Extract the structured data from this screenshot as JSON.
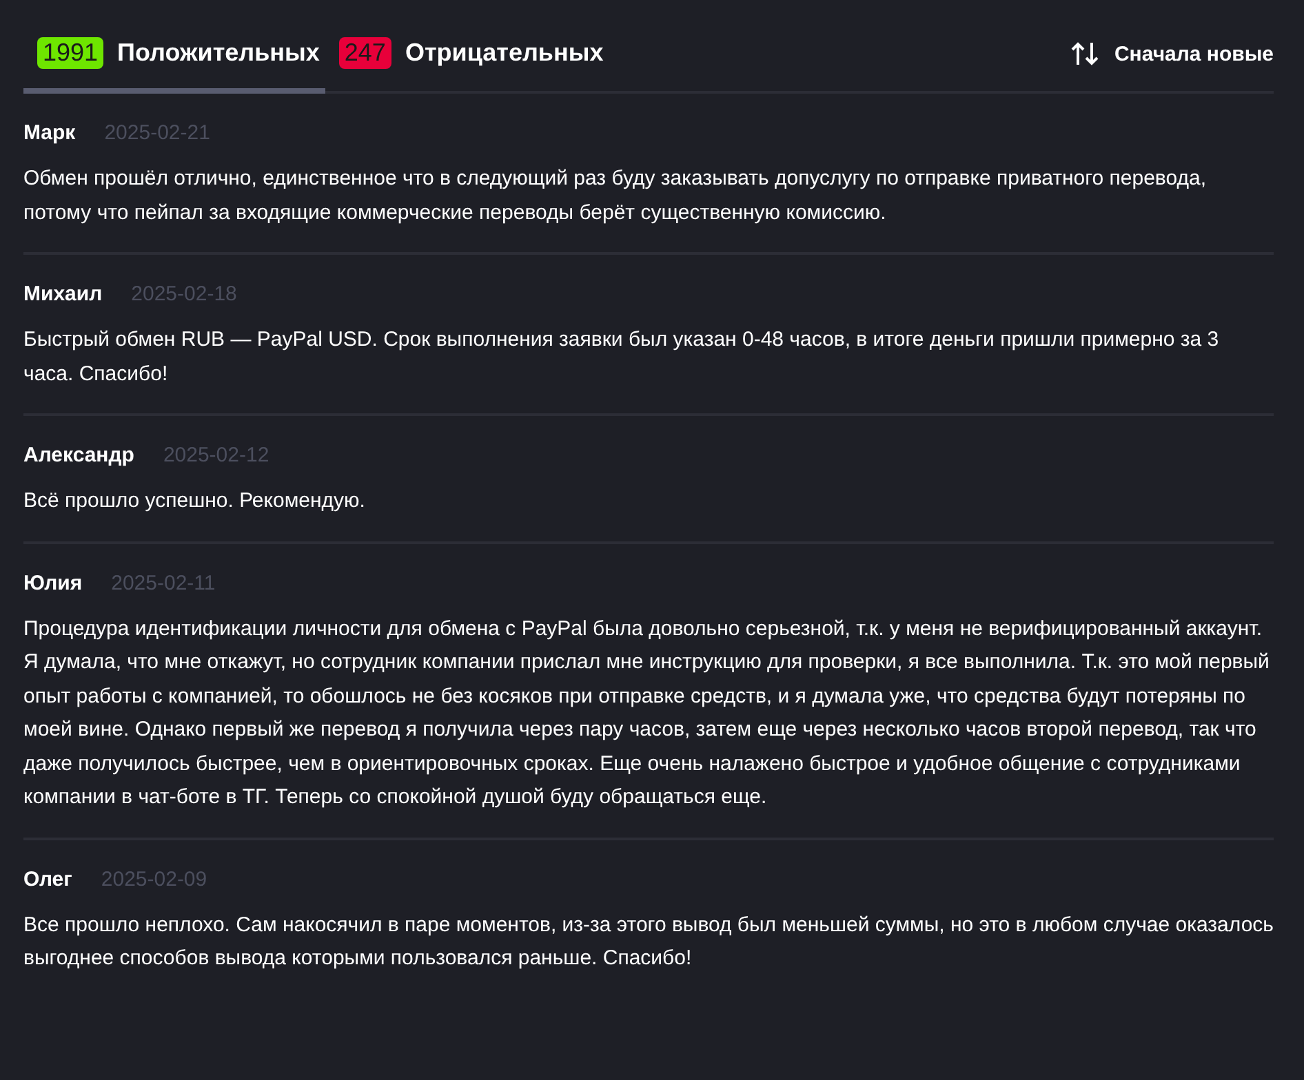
{
  "tabs": [
    {
      "count": "1991",
      "label": "Положительных",
      "kind": "positive",
      "selected": true
    },
    {
      "count": "247",
      "label": "Отрицательных",
      "kind": "negative",
      "selected": false
    }
  ],
  "sort": {
    "label": "Сначала новые"
  },
  "reviews": [
    {
      "author": "Марк",
      "date": "2025-02-21",
      "text": "Обмен прошёл отлично, единственное что в следующий раз буду заказывать допуслугу по отправке приватного перевода, потому что пейпал за входящие коммерческие переводы берёт существенную комиссию."
    },
    {
      "author": "Михаил",
      "date": "2025-02-18",
      "text": "Быстрый обмен RUB — PayPal USD. Срок выполнения заявки был указан 0-48 часов, в итоге деньги пришли примерно за 3 часа. Спасибо!"
    },
    {
      "author": "Александр",
      "date": "2025-02-12",
      "text": "Всё прошло успешно. Рекомендую."
    },
    {
      "author": "Юлия",
      "date": "2025-02-11",
      "text": "Процедура идентификации личности для обмена с PayPal была довольно серьезной, т.к. у меня не верифицированный аккаунт. Я думала, что мне откажут, но сотрудник компании прислал мне инструкцию для проверки, я все выполнила. Т.к. это мой первый опыт работы с компанией, то обошлось не без косяков при отправке средств, и я думала уже, что средства будут потеряны по моей вине. Однако первый же перевод я получила через пару часов, затем еще через несколько часов второй перевод, так что даже получилось быстрее, чем в ориентировочных сроках. Еще очень налажено быстрое и удобное общение с сотрудниками компании в чат-боте в ТГ. Теперь со спокойной душой буду обращаться еще."
    },
    {
      "author": "Олег",
      "date": "2025-02-09",
      "text": "Все прошло неплохо. Сам накосячил в паре моментов, из-за этого вывод был меньшей суммы, но это в любом случае оказалось выгоднее способов вывода которыми пользовался раньше. Спасибо!"
    }
  ]
}
